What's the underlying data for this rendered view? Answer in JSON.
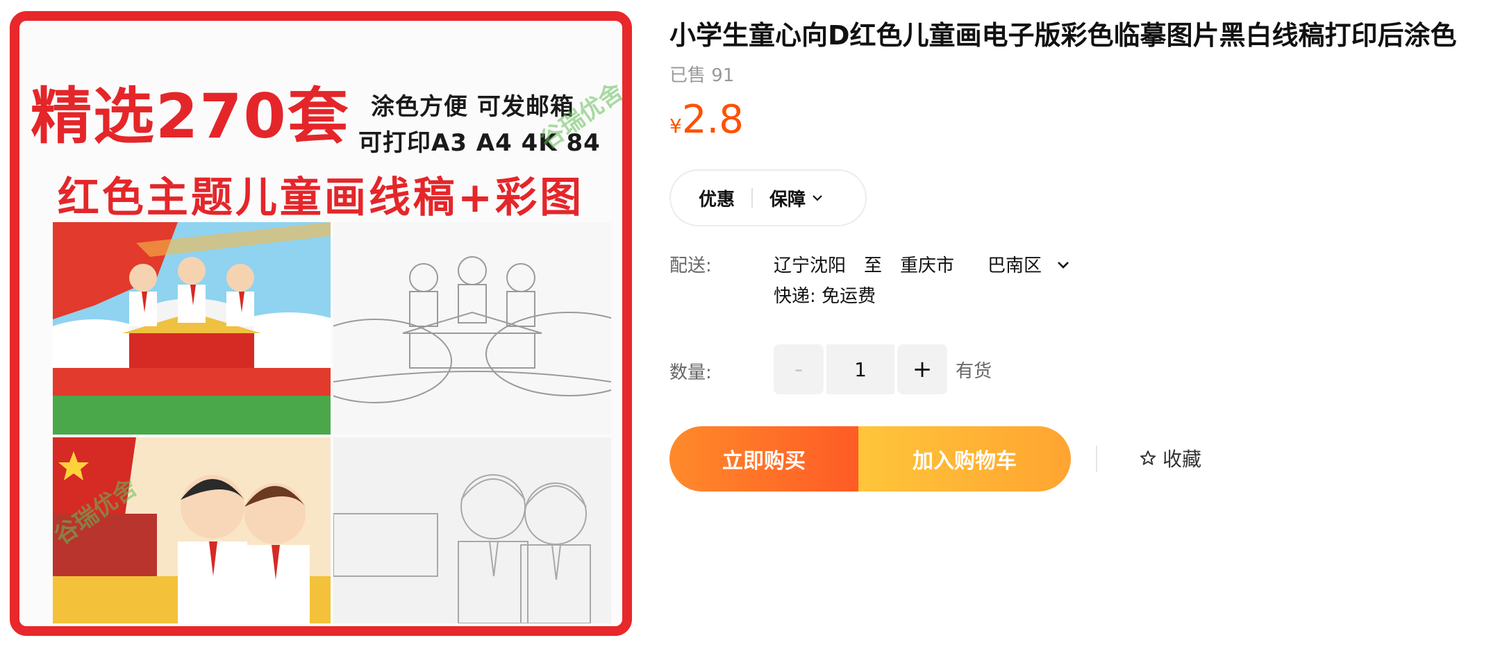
{
  "gallery": {
    "promo_big": "精选270套",
    "promo_line1": "涂色方便 可发邮箱",
    "promo_line2": "可打印A3 A4 4K 84",
    "promo_sub": "红色主题儿童画线稿+彩图",
    "watermark": "谷瑞优舍"
  },
  "product": {
    "title": "小学生童心向D红色儿童画电子版彩色临摹图片黑白线稿打印后涂色",
    "sold": "已售 91",
    "currency": "¥",
    "price": "2.8"
  },
  "promo_pill": {
    "youhui": "优惠",
    "baozhang": "保障"
  },
  "shipping": {
    "label": "配送:",
    "from": "辽宁沈阳",
    "to_word": "至",
    "city": "重庆市",
    "district": "巴南区",
    "express": "快递: 免运费"
  },
  "quantity": {
    "label": "数量:",
    "minus": "-",
    "value": "1",
    "plus": "+",
    "stock": "有货"
  },
  "actions": {
    "buy_now": "立即购买",
    "add_cart": "加入购物车",
    "favorite": "收藏"
  },
  "colors": {
    "accent": "#ff5000",
    "frame_red": "#e8282b",
    "buy_start": "#ff8a2a",
    "buy_end": "#ff5b26",
    "cart_start": "#ffc53a",
    "cart_end": "#ffa431"
  },
  "icons": {
    "pill_chevron": "chevron-down-icon",
    "district_chevron": "chevron-down-icon",
    "favorite": "star-icon"
  }
}
